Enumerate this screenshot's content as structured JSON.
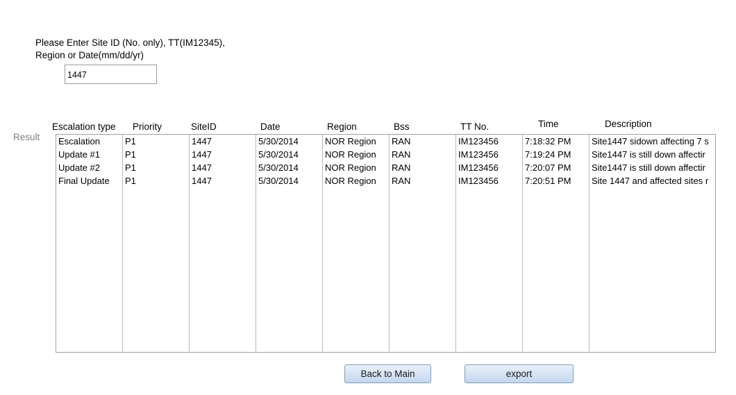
{
  "prompt": {
    "line1": "Please Enter Site ID (No. only), TT(IM12345),",
    "line2": "Region or Date(mm/dd/yr)"
  },
  "search": {
    "value": "1447"
  },
  "result_label": "Result",
  "table": {
    "headers": [
      "Escalation type",
      "Priority",
      "SiteID",
      "Date",
      "Region",
      "Bss",
      "TT No.",
      "Time",
      "Description"
    ],
    "rows": [
      [
        "Escalation",
        "P1",
        "1447",
        "5/30/2014",
        "NOR Region",
        "RAN",
        "IM123456",
        "7:18:32 PM",
        "Site1447 sidown affecting 7 s"
      ],
      [
        "Update #1",
        "P1",
        "1447",
        "5/30/2014",
        "NOR Region",
        "RAN",
        "IM123456",
        "7:19:24 PM",
        "Site1447 is still down affectir"
      ],
      [
        "Update #2",
        "P1",
        "1447",
        "5/30/2014",
        "NOR Region",
        "RAN",
        "IM123456",
        "7:20:07 PM",
        "Site1447 is still down affectir"
      ],
      [
        "Final Update",
        "P1",
        "1447",
        "5/30/2014",
        "NOR Region",
        "RAN",
        "IM123456",
        "7:20:51 PM",
        "Site 1447 and affected sites r"
      ]
    ]
  },
  "buttons": {
    "back": "Back to Main",
    "export": "export"
  }
}
